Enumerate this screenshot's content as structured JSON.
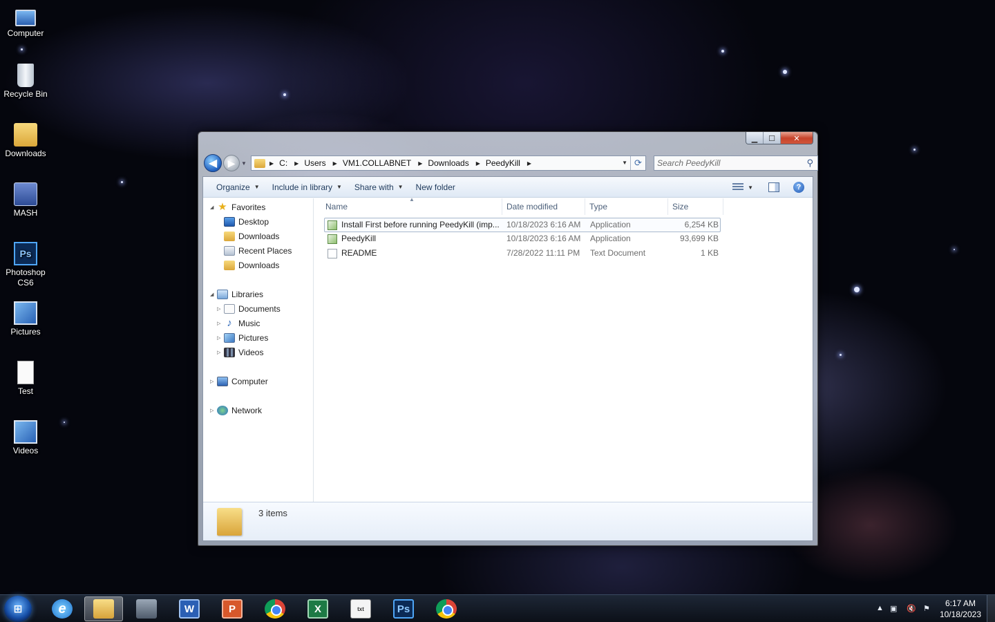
{
  "desktop": {
    "icons": [
      {
        "label": "Computer",
        "icon": "computer-icon"
      },
      {
        "label": "Recycle Bin",
        "icon": "recycle-bin-icon"
      },
      {
        "label": "Downloads",
        "icon": "folder-icon"
      },
      {
        "label": "MASH",
        "icon": "app-shortcut-icon"
      },
      {
        "label": "Photoshop CS6",
        "icon": "photoshop-icon"
      },
      {
        "label": "Pictures",
        "icon": "pictures-icon"
      },
      {
        "label": "Test",
        "icon": "docx-icon"
      },
      {
        "label": "Videos",
        "icon": "videos-icon"
      }
    ]
  },
  "window": {
    "caption_buttons": {
      "minimize": "▁",
      "maximize": "☐",
      "close": "✕"
    },
    "nav": {
      "back": "◀",
      "forward": "▶"
    },
    "breadcrumb": [
      "C:",
      "Users",
      "VM1.COLLABNET",
      "Downloads",
      "PeedyKill"
    ],
    "search": {
      "placeholder": "Search PeedyKill",
      "value": ""
    },
    "toolbar": {
      "organize": "Organize",
      "include_in_library": "Include in library",
      "share_with": "Share with",
      "new_folder": "New folder"
    },
    "nav_pane": {
      "favorites": {
        "label": "Favorites",
        "items": [
          "Desktop",
          "Downloads",
          "Recent Places",
          "Downloads"
        ]
      },
      "libraries": {
        "label": "Libraries",
        "items": [
          "Documents",
          "Music",
          "Pictures",
          "Videos"
        ]
      },
      "computer": "Computer",
      "network": "Network"
    },
    "columns": {
      "name": "Name",
      "date_modified": "Date modified",
      "type": "Type",
      "size": "Size"
    },
    "files": [
      {
        "name": "Install First before running PeedyKill (imp...",
        "date": "10/18/2023 6:16 AM",
        "type": "Application",
        "size": "6,254 KB",
        "icon": "application-icon",
        "selected": true
      },
      {
        "name": "PeedyKill",
        "date": "10/18/2023 6:16 AM",
        "type": "Application",
        "size": "93,699 KB",
        "icon": "application-icon",
        "selected": false
      },
      {
        "name": "README",
        "date": "7/28/2022 11:11 PM",
        "type": "Text Document",
        "size": "1 KB",
        "icon": "text-document-icon",
        "selected": false
      }
    ],
    "details": {
      "item_count": "3 items"
    }
  },
  "taskbar": {
    "apps": [
      "Internet Explorer",
      "Windows Explorer",
      "Resource Monitor",
      "Word",
      "PowerPoint",
      "Chrome",
      "Excel",
      "Notepad",
      "Photoshop",
      "Chrome"
    ],
    "glyphs": {
      "word": "W",
      "powerpoint": "P",
      "excel": "X",
      "notepad": "txt",
      "photoshop": "Ps",
      "ie": "e"
    },
    "tray": {
      "time": "6:17 AM",
      "date": "10/18/2023"
    }
  }
}
